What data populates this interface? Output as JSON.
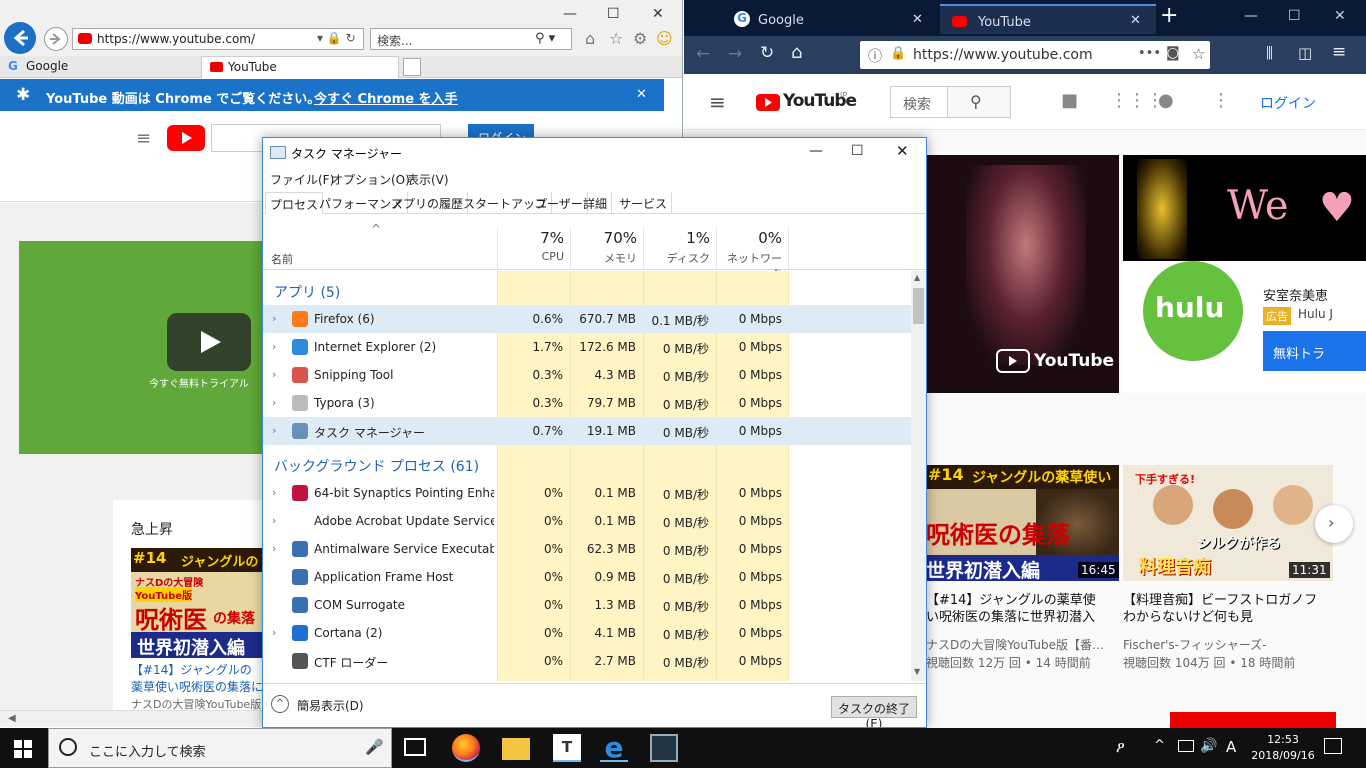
{
  "ie": {
    "url": "https://www.youtube.com/",
    "search_placeholder": "検索...",
    "tabs": [
      {
        "label": "Google"
      },
      {
        "label": "YouTube"
      }
    ],
    "banner_message": "YouTube 動画は Chrome でご覧ください。",
    "banner_link": "今すぐ Chrome を入手",
    "login_label": "ログイン",
    "ad_overlay_text": "今すぐ無料トライアル",
    "trending_title": "急上昇",
    "trending_video_title": "【#14】ジャングルの薬草使い呪術医の集落に世界初潜入",
    "trending_channel": "ナスDの大冒険YouTube版",
    "thumb_badge": "#14",
    "thumb_line1": "ジャングルの",
    "thumb_line2": "ナスDの大冒険",
    "thumb_line3": "YouTube版",
    "thumb_line4": "呪術医",
    "thumb_line5": "の集落",
    "thumb_line6": "世界初潜入編"
  },
  "firefox": {
    "tabs": [
      {
        "label": "Google"
      },
      {
        "label": "YouTube"
      }
    ],
    "url": "https://www.youtube.com",
    "search_placeholder": "検索",
    "login_label": "ログイン",
    "logo_region": "JP",
    "banner_overlay": "YouTube",
    "hulu_text": "hulu",
    "hulu_title": "安室奈美恵",
    "hulu_ad_badge": "広告",
    "hulu_channel": "Hulu J",
    "hulu_cta": "無料トラ",
    "we_text": "We",
    "videos": [
      {
        "title": "【#14】ジャングルの薬草使い呪術医の集落に世界初潜入",
        "channel": "ナスDの大冒険YouTube版【番…",
        "meta": "視聴回数 12万 回 • 14 時間前",
        "duration": "16:45",
        "thumb_top": "ジャングルの薬草使い",
        "thumb_badge": "#14",
        "thumb_mid": "呪術医の集落",
        "thumb_bottom": "世界初潜入編"
      },
      {
        "title": "【料理音痴】ビーフストロガノフわからないけど何も見",
        "channel": "Fischer's-フィッシャーズ-",
        "meta": "視聴回数 104万 回 • 18 時間前",
        "duration": "11:31",
        "thumb_top": "下手すぎる!",
        "thumb_mid": "シルクが作る",
        "thumb_bottom": "料理音痴"
      }
    ]
  },
  "taskmgr": {
    "title": "タスク マネージャー",
    "menu": [
      "ファイル(F)",
      "オプション(O)",
      "表示(V)"
    ],
    "tabs": [
      "プロセス",
      "パフォーマンス",
      "アプリの履歴",
      "スタートアップ",
      "ユーザー",
      "詳細",
      "サービス"
    ],
    "col_name": "名前",
    "columns": [
      {
        "pct": "7%",
        "label": "CPU"
      },
      {
        "pct": "70%",
        "label": "メモリ"
      },
      {
        "pct": "1%",
        "label": "ディスク"
      },
      {
        "pct": "0%",
        "label": "ネットワーク"
      }
    ],
    "group_apps": "アプリ (5)",
    "group_bg": "バックグラウンド プロセス (61)",
    "apps": [
      {
        "name": "Firefox (6)",
        "cpu": "0.6%",
        "mem": "670.7 MB",
        "disk": "0.1 MB/秒",
        "net": "0 Mbps"
      },
      {
        "name": "Internet Explorer (2)",
        "cpu": "1.7%",
        "mem": "172.6 MB",
        "disk": "0 MB/秒",
        "net": "0 Mbps"
      },
      {
        "name": "Snipping Tool",
        "cpu": "0.3%",
        "mem": "4.3 MB",
        "disk": "0 MB/秒",
        "net": "0 Mbps"
      },
      {
        "name": "Typora (3)",
        "cpu": "0.3%",
        "mem": "79.7 MB",
        "disk": "0 MB/秒",
        "net": "0 Mbps"
      },
      {
        "name": "タスク マネージャー",
        "cpu": "0.7%",
        "mem": "19.1 MB",
        "disk": "0 MB/秒",
        "net": "0 Mbps"
      }
    ],
    "background": [
      {
        "name": "64-bit Synaptics Pointing Enhan...",
        "cpu": "0%",
        "mem": "0.1 MB",
        "disk": "0 MB/秒",
        "net": "0 Mbps"
      },
      {
        "name": "Adobe Acrobat Update Service (...",
        "cpu": "0%",
        "mem": "0.1 MB",
        "disk": "0 MB/秒",
        "net": "0 Mbps"
      },
      {
        "name": "Antimalware Service Executable",
        "cpu": "0%",
        "mem": "62.3 MB",
        "disk": "0 MB/秒",
        "net": "0 Mbps"
      },
      {
        "name": "Application Frame Host",
        "cpu": "0%",
        "mem": "0.9 MB",
        "disk": "0 MB/秒",
        "net": "0 Mbps"
      },
      {
        "name": "COM Surrogate",
        "cpu": "0%",
        "mem": "1.3 MB",
        "disk": "0 MB/秒",
        "net": "0 Mbps"
      },
      {
        "name": "Cortana (2)",
        "cpu": "0%",
        "mem": "4.1 MB",
        "disk": "0 MB/秒",
        "net": "0 Mbps"
      },
      {
        "name": "CTF ローダー",
        "cpu": "0%",
        "mem": "2.7 MB",
        "disk": "0 MB/秒",
        "net": "0 Mbps"
      }
    ],
    "fewer_details": "簡易表示(D)",
    "end_task": "タスクの終了(E)"
  },
  "taskbar": {
    "search_placeholder": "ここに入力して検索",
    "time": "12:53",
    "date": "2018/09/16",
    "ime": "A"
  },
  "colors": {
    "ie_banner": "#1a73c8",
    "ff_titlebar": "#0a1a36",
    "ff_nav": "#2a3f5e",
    "yt_red": "#ff0000",
    "tm_accent": "#1e63b8",
    "tm_highlight": "#fff4c4"
  }
}
